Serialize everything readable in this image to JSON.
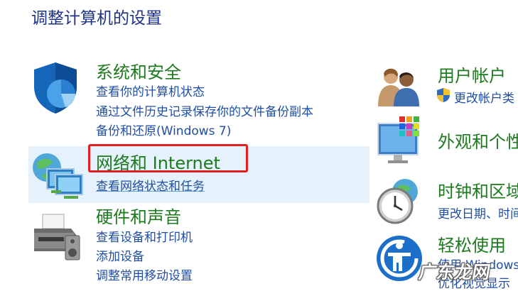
{
  "page_title": "调整计算机的设置",
  "left": {
    "system": {
      "title": "系统和安全",
      "links": [
        "查看你的计算机状态",
        "通过文件历史记录保存你的文件备份副本",
        "备份和还原(Windows 7)"
      ]
    },
    "network": {
      "title": "网络和 Internet",
      "links": [
        "查看网络状态和任务"
      ]
    },
    "hardware": {
      "title": "硬件和声音",
      "links": [
        "查看设备和打印机",
        "添加设备",
        "调整常用移动设置"
      ]
    }
  },
  "right": {
    "users": {
      "title": "用户帐户",
      "link": "更改帐户类"
    },
    "appearance": {
      "title": "外观和个性"
    },
    "clock": {
      "title": "时钟和区域",
      "link": "更改日期、时间"
    },
    "ease": {
      "title": "轻松使用",
      "links": [
        "使用 Windows",
        "优化视觉显示"
      ]
    }
  },
  "watermark": "广东龙网",
  "colors": {
    "title": "#1e3287",
    "category": "#1e7a1e",
    "link": "#1f4ea3",
    "highlight_bg": "#e5f1fb",
    "annotation": "#e02020"
  }
}
